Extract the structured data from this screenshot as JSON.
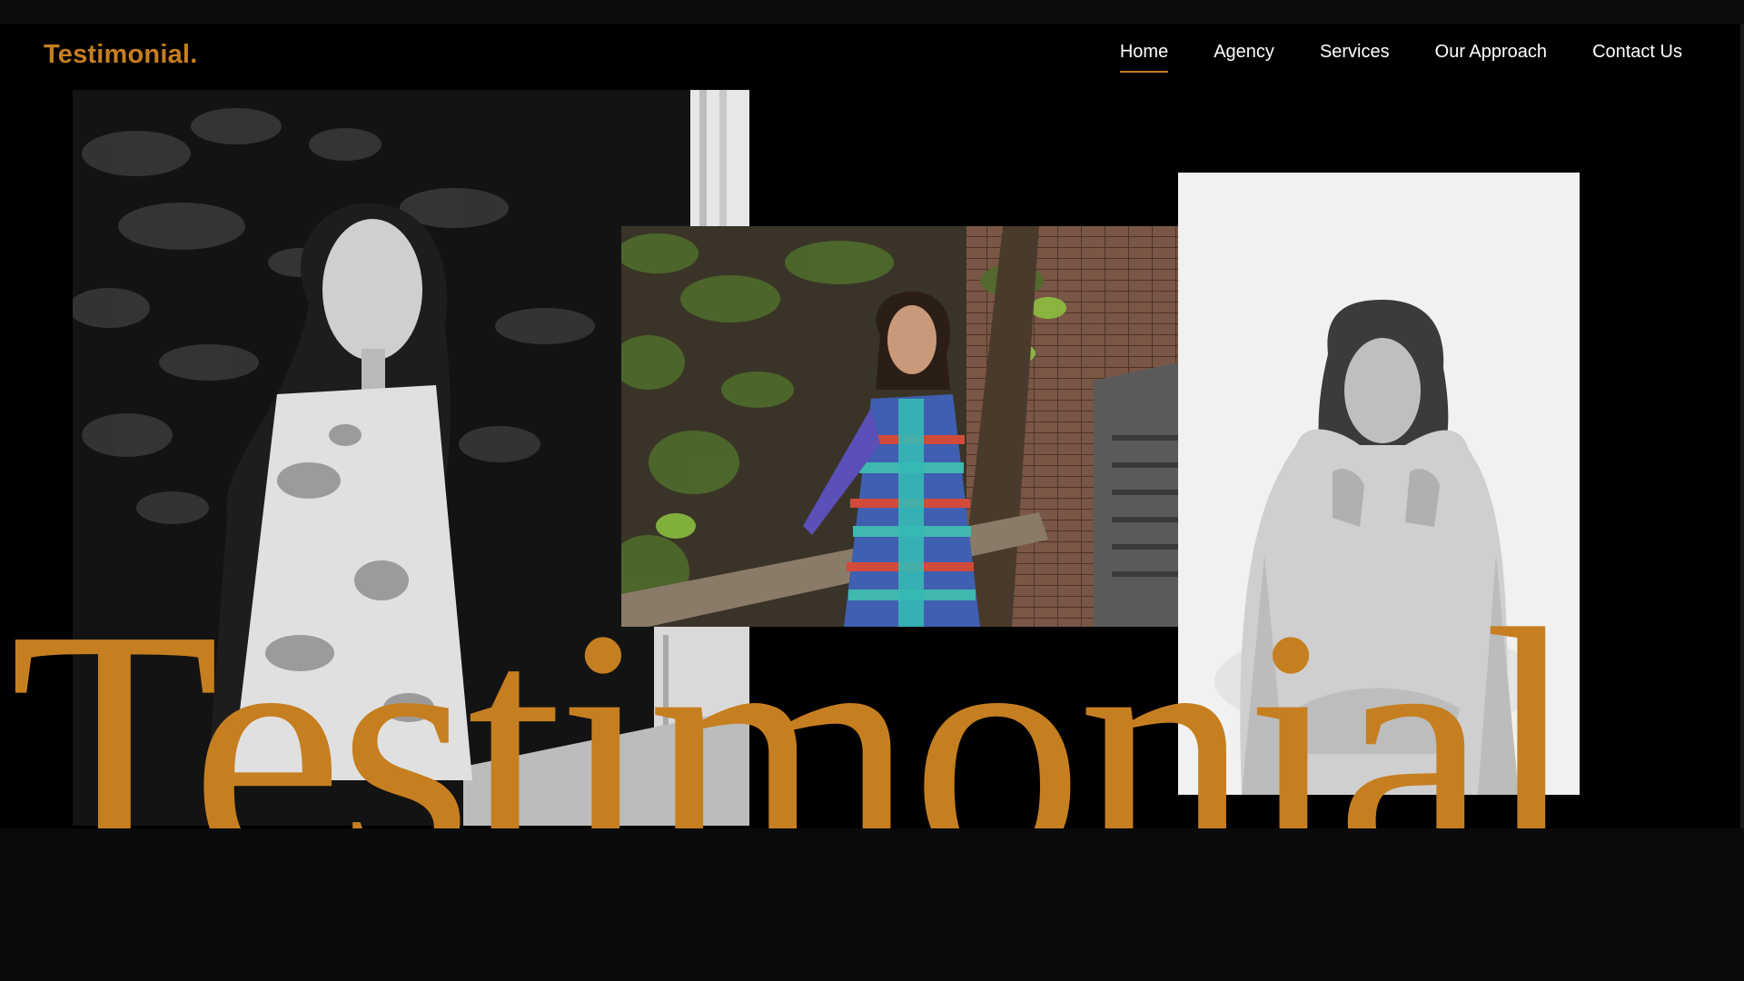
{
  "brand": {
    "logo_text": "Testimonial."
  },
  "nav": {
    "items": [
      {
        "label": "Home",
        "active": true
      },
      {
        "label": "Agency",
        "active": false
      },
      {
        "label": "Services",
        "active": false
      },
      {
        "label": "Our Approach",
        "active": false
      },
      {
        "label": "Contact Us",
        "active": false
      }
    ]
  },
  "hero": {
    "title": "Testimonial."
  },
  "photos": [
    {
      "name": "photo-model-floral",
      "tone": "grayscale"
    },
    {
      "name": "photo-model-patterned-tunic",
      "tone": "color"
    },
    {
      "name": "photo-model-hoodie",
      "tone": "grayscale"
    }
  ],
  "colors": {
    "accent": "#c67f20",
    "background": "#000000",
    "nav_text": "#ffffff",
    "page_band": "#0a0a0a"
  }
}
